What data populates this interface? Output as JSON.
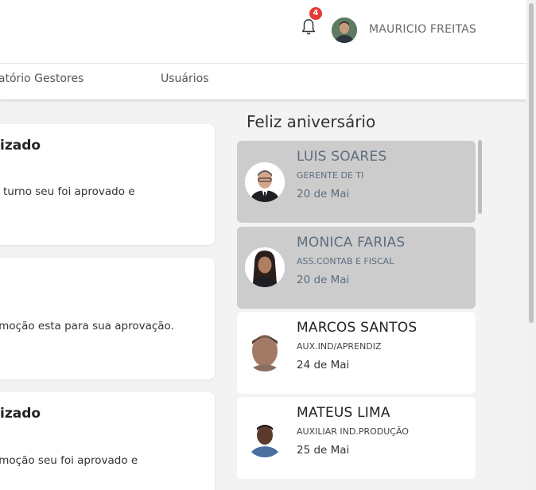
{
  "header": {
    "notification_count": "4",
    "user_name": "MAURICIO FREITAS"
  },
  "nav": {
    "items": [
      {
        "label": "latório Gestores"
      },
      {
        "label": "Usuários"
      }
    ]
  },
  "notifications": [
    {
      "title": "izado",
      "text": "turno seu foi aprovado e"
    },
    {
      "title": "",
      "text": "omoção esta para sua aprovação."
    },
    {
      "title": "izado",
      "text": "omoção seu foi aprovado e"
    }
  ],
  "birthdays": {
    "title": "Feliz aniversário",
    "people": [
      {
        "name": "LUIS SOARES",
        "role": "GERENTE DE TI",
        "date": "20 de Mai"
      },
      {
        "name": "MONICA FARIAS",
        "role": "ASS.CONTAB E FISCAL",
        "date": "20 de Mai"
      },
      {
        "name": "MARCOS SANTOS",
        "role": "AUX.IND/APRENDIZ",
        "date": "24 de Mai"
      },
      {
        "name": "MATEUS LIMA",
        "role": "AUXILIAR IND.PRODUÇÃO",
        "date": "25 de Mai"
      }
    ]
  },
  "colors": {
    "highlight_card": "#cccccc",
    "badge": "#e53935"
  }
}
